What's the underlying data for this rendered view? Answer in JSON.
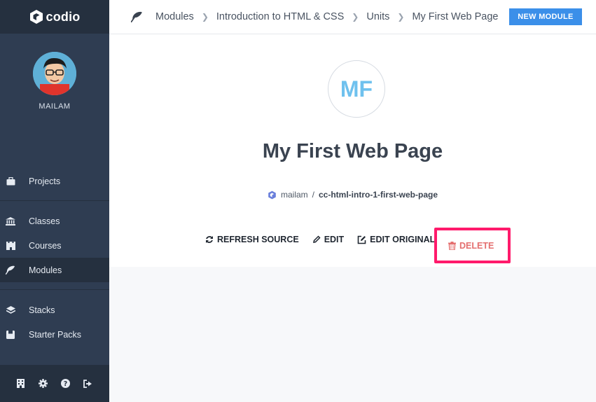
{
  "app": {
    "logo_text": "codio"
  },
  "user": {
    "name": "MAILAM"
  },
  "sidebar": {
    "items": [
      {
        "label": "Projects",
        "icon": "briefcase-icon"
      },
      {
        "label": "Classes",
        "icon": "institution-icon"
      },
      {
        "label": "Courses",
        "icon": "castle-icon"
      },
      {
        "label": "Modules",
        "icon": "modules-icon",
        "active": true
      },
      {
        "label": "Stacks",
        "icon": "layers-icon"
      },
      {
        "label": "Starter Packs",
        "icon": "box-icon"
      }
    ],
    "footer_icons": [
      "building-icon",
      "gear-icon",
      "help-icon",
      "logout-icon"
    ]
  },
  "breadcrumb": {
    "items": [
      "Modules",
      "Introduction to HTML & CSS",
      "Units",
      "My First Web Page"
    ]
  },
  "header": {
    "new_module_label": "NEW MODULE"
  },
  "module": {
    "initials": "MF",
    "title": "My First Web Page",
    "owner": "mailam",
    "separator": "/",
    "slug": "cc-html-intro-1-first-web-page"
  },
  "actions": {
    "refresh": "REFRESH SOURCE",
    "edit": "EDIT",
    "edit_original": "EDIT ORIGINAL",
    "delete": "DELETE"
  },
  "colors": {
    "sidebar": "#2f3d52",
    "sidebar_dark": "#25303f",
    "primary": "#3b8fe9",
    "highlight": "#ff1a6b",
    "delete": "#e46f6f",
    "initials": "#6fc1ee"
  }
}
